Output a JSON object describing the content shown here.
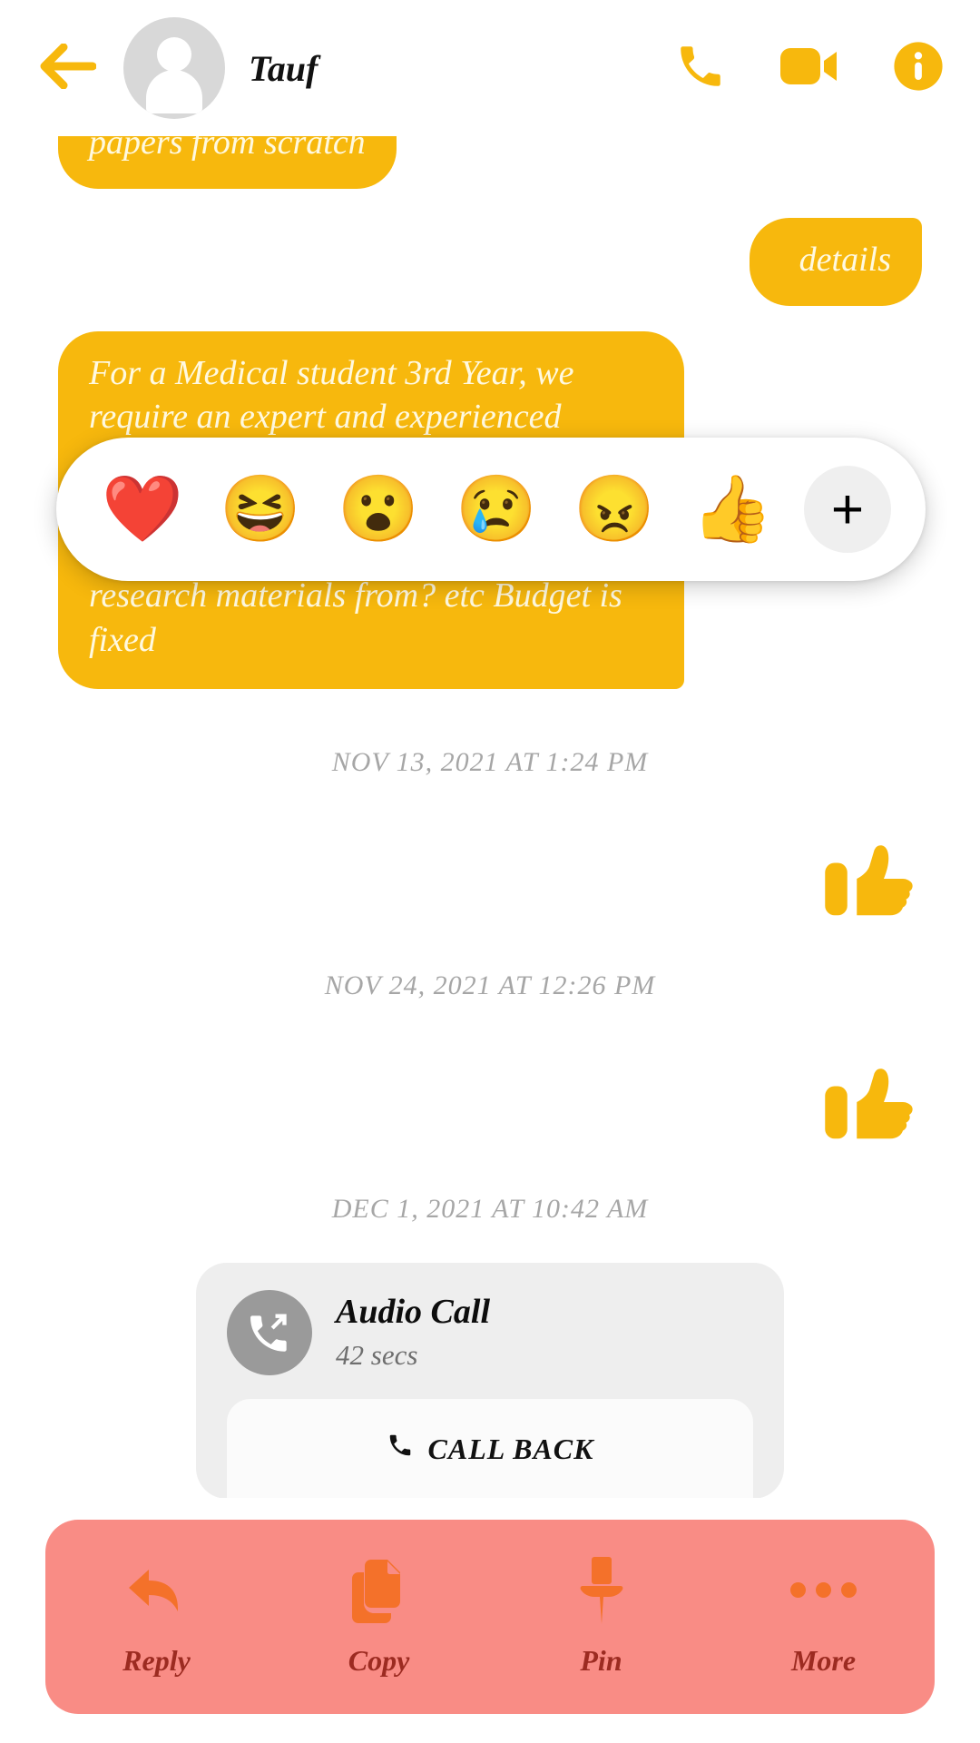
{
  "theme": {
    "accent_yellow": "#F7B80D",
    "bubble_text": "#FFF9E0",
    "action_bar_bg": "#F98C85",
    "action_icon": "#F4712A",
    "action_label": "#9C2B21",
    "timestamp_gray": "#A6A6A6",
    "call_card_bg": "#EEEEEE"
  },
  "header": {
    "back_icon": "arrow-left-icon",
    "avatar_icon": "person-placeholder-icon",
    "contact_name": "Tauf",
    "actions": [
      {
        "name": "voice-call-button",
        "icon": "phone-icon"
      },
      {
        "name": "video-call-button",
        "icon": "video-camera-icon"
      },
      {
        "name": "contact-info-button",
        "icon": "info-circle-icon"
      }
    ]
  },
  "thread": {
    "messages": [
      {
        "id": "msg-clipped",
        "direction": "incoming",
        "clipped": true,
        "text": "papers from scratch"
      },
      {
        "id": "msg-details",
        "direction": "outgoing",
        "text": "details"
      },
      {
        "id": "msg-requirements",
        "direction": "incoming",
        "text_top": "For a Medical student 3rd Year, we require an expert and experienced",
        "text_bottom": "research materials from? etc Budget is fixed"
      }
    ],
    "timestamps": [
      "NOV 13, 2021 AT 1:24 PM",
      "NOV 24, 2021 AT 12:26 PM",
      "DEC 1, 2021 AT 10:42 AM"
    ],
    "stickers": [
      {
        "id": "sticker-thumbsup-1",
        "name": "thumbs-up-sticker",
        "glyph": "👍"
      },
      {
        "id": "sticker-thumbsup-2",
        "name": "thumbs-up-sticker",
        "glyph": "👍"
      }
    ],
    "call_card": {
      "icon": "outgoing-call-icon",
      "title": "Audio Call",
      "duration": "42 secs",
      "call_back_label": "CALL BACK",
      "call_back_icon": "phone-icon"
    }
  },
  "reaction_bar": {
    "reactions": [
      {
        "name": "reaction-heart",
        "glyph": "❤️",
        "label": "heart"
      },
      {
        "name": "reaction-laugh",
        "glyph": "😆",
        "label": "laugh"
      },
      {
        "name": "reaction-wow",
        "glyph": "😮",
        "label": "wow"
      },
      {
        "name": "reaction-sad",
        "glyph": "😢",
        "label": "sad"
      },
      {
        "name": "reaction-angry",
        "glyph": "😠",
        "label": "angry"
      },
      {
        "name": "reaction-thumbsup",
        "glyph": "👍",
        "label": "thumbs up"
      }
    ],
    "add_label": "+",
    "add_icon": "plus-icon"
  },
  "action_bar": {
    "items": [
      {
        "name": "reply-button",
        "label": "Reply",
        "icon": "reply-arrow-icon"
      },
      {
        "name": "copy-button",
        "label": "Copy",
        "icon": "copy-pages-icon"
      },
      {
        "name": "pin-button",
        "label": "Pin",
        "icon": "pushpin-icon"
      },
      {
        "name": "more-button",
        "label": "More",
        "icon": "ellipsis-icon"
      }
    ]
  }
}
